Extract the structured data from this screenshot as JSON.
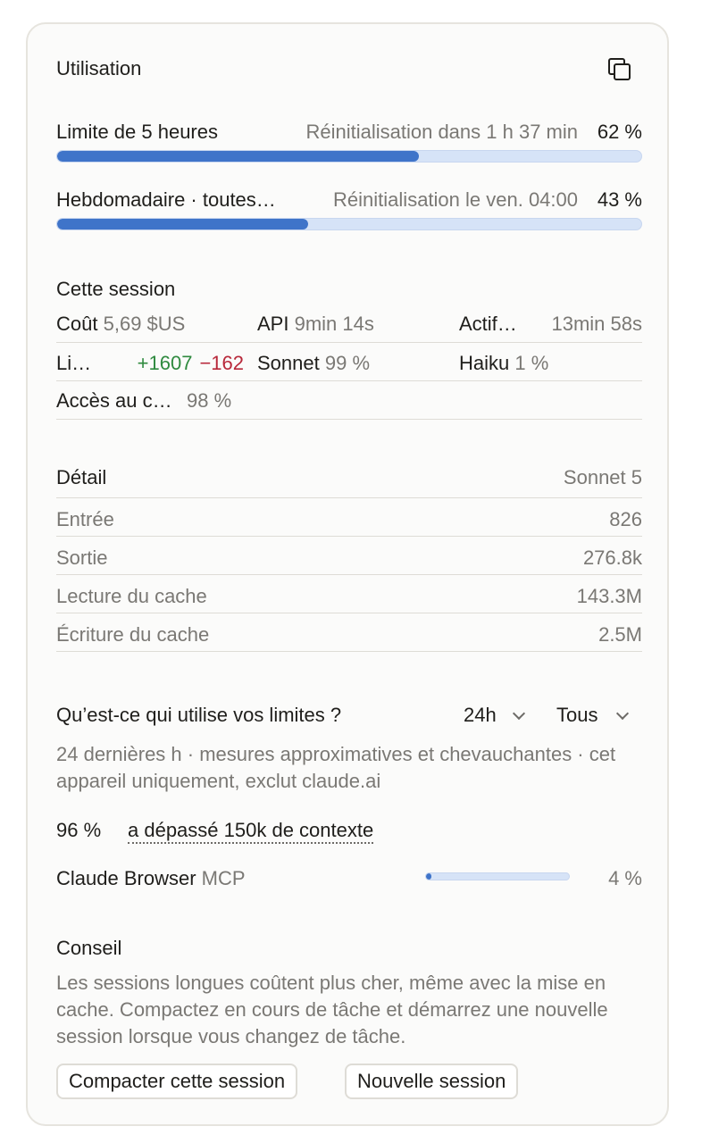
{
  "header": {
    "title": "Utilisation",
    "copy_icon": "copy-icon"
  },
  "limits": [
    {
      "label": "Limite de 5 heures",
      "reset": "Réinitialisation dans 1 h 37 min",
      "percent_label": "62 %",
      "percent": 62
    },
    {
      "label": "Hebdomadaire · toutes les sessions",
      "reset": "Réinitialisation le ven. 04:00",
      "percent_label": "43 %",
      "percent": 43
    }
  ],
  "session": {
    "title": "Cette session",
    "cost_label": "Coût",
    "cost_value": "5,69 $US",
    "api_label": "API",
    "api_value": "9min 14s",
    "active_label": "Actif",
    "active_value": "13min 58s",
    "lines_label": "Lignes",
    "lines_added": "+1607",
    "lines_removed": "−162",
    "sonnet_label": "Sonnet",
    "sonnet_value": "99 %",
    "haiku_label": "Haiku",
    "haiku_value": "1 %",
    "cache_label": "Accès au cache",
    "cache_value": "98 %"
  },
  "detail": {
    "title": "Détail",
    "model": "Sonnet 5",
    "rows": [
      {
        "label": "Entrée",
        "value": "826"
      },
      {
        "label": "Sortie",
        "value": "276.8k"
      },
      {
        "label": "Lecture du cache",
        "value": "143.3M"
      },
      {
        "label": "Écriture du cache",
        "value": "2.5M"
      }
    ]
  },
  "usage": {
    "title": "Qu’est-ce qui utilise vos limites ?",
    "range_select": "24h",
    "filter_select": "Tous",
    "description": "24 dernières h · mesures approximatives et chevauchantes · cet appareil uniquement, exclut claude.ai",
    "context_percent": "96 %",
    "context_label": "a dépassé 150k de contexte",
    "item_name": "Claude Browser",
    "item_type": "MCP",
    "item_percent_label": "4 %",
    "item_percent": 4
  },
  "tip": {
    "title": "Conseil",
    "text": "Les sessions longues coûtent plus cher, même avec la mise en cache. Compactez en cours de tâche et démarrez une nouvelle session lorsque vous changez de tâche.",
    "compact_button": "Compacter cette session",
    "new_button": "Nouvelle session"
  }
}
